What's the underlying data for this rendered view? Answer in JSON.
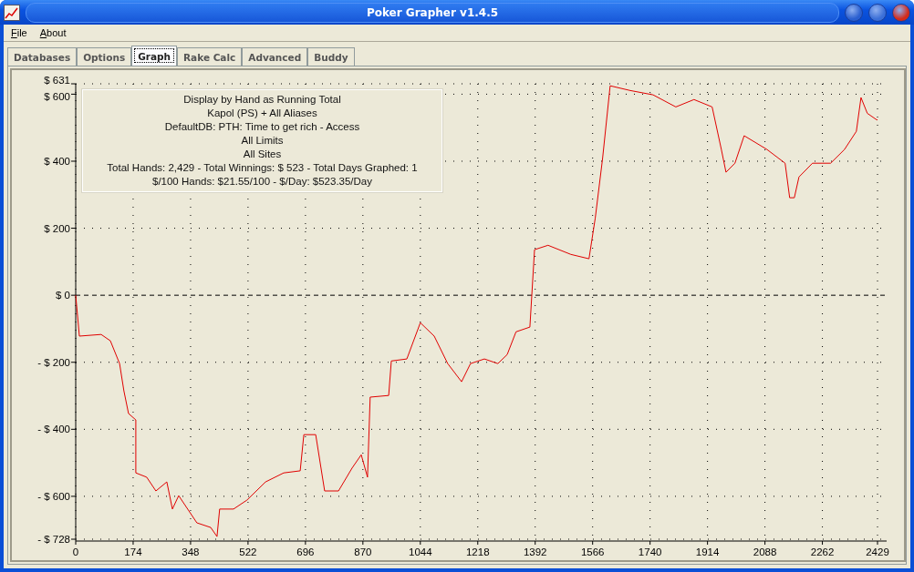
{
  "window": {
    "title": "Poker Grapher v1.4.5"
  },
  "menu": [
    "File",
    "About"
  ],
  "tabs": [
    {
      "label": "Databases",
      "selected": false
    },
    {
      "label": "Options",
      "selected": false
    },
    {
      "label": "Graph",
      "selected": true
    },
    {
      "label": "Rake Calc",
      "selected": false
    },
    {
      "label": "Advanced",
      "selected": false
    },
    {
      "label": "Buddy",
      "selected": false
    }
  ],
  "info_box": [
    "Display by Hand as Running Total",
    "Kapol (PS) + All Aliases",
    "DefaultDB: PTH: Time to get rich - Access",
    "All Limits",
    "All Sites",
    "Total Hands: 2,429 - Total Winnings: $ 523 - Total Days Graphed: 1",
    "$/100 Hands: $21.55/100 - $/Day: $523.35/Day"
  ],
  "chart": {
    "chart_data": {
      "type": "line",
      "grid": true,
      "xlim": [
        0,
        2429
      ],
      "ylim": [
        -728,
        631
      ],
      "xticks": [
        0,
        174,
        348,
        522,
        696,
        870,
        1044,
        1218,
        1392,
        1566,
        1740,
        1914,
        2088,
        2262,
        2429
      ],
      "yticks": [
        {
          "value": 631,
          "label": "$ 631"
        },
        {
          "value": 600,
          "label": "$ 600"
        },
        {
          "value": 400,
          "label": "$ 400"
        },
        {
          "value": 200,
          "label": "$ 200"
        },
        {
          "value": 0,
          "label": "$ 0"
        },
        {
          "value": -200,
          "label": "- $ 200"
        },
        {
          "value": -400,
          "label": "- $ 400"
        },
        {
          "value": -600,
          "label": "- $ 600"
        },
        {
          "value": -728,
          "label": "- $ 728"
        }
      ],
      "x": [
        0,
        11,
        77,
        105,
        133,
        146,
        160,
        182,
        182,
        215,
        243,
        276,
        293,
        312,
        367,
        409,
        428,
        436,
        478,
        519,
        575,
        630,
        680,
        691,
        727,
        754,
        796,
        837,
        865,
        884,
        892,
        948,
        956,
        1003,
        1044,
        1086,
        1127,
        1169,
        1196,
        1238,
        1279,
        1307,
        1334,
        1376,
        1390,
        1431,
        1500,
        1555,
        1574,
        1596,
        1619,
        1680,
        1749,
        1818,
        1873,
        1928,
        1956,
        1970,
        1997,
        2025,
        2094,
        2149,
        2163,
        2177,
        2191,
        2232,
        2287,
        2329,
        2365,
        2379,
        2398,
        2426,
        2429
      ],
      "series": [
        {
          "color": "#e00000",
          "values": [
            0,
            -122,
            -117,
            -136,
            -204,
            -285,
            -353,
            -372,
            -530,
            -543,
            -584,
            -557,
            -638,
            -598,
            -679,
            -693,
            -720,
            -638,
            -638,
            -611,
            -557,
            -530,
            -524,
            -416,
            -416,
            -584,
            -584,
            -516,
            -476,
            -543,
            -304,
            -299,
            -196,
            -190,
            -82,
            -122,
            -204,
            -258,
            -204,
            -190,
            -204,
            -177,
            -109,
            -95,
            136,
            149,
            122,
            109,
            231,
            408,
            625,
            611,
            598,
            562,
            584,
            562,
            435,
            367,
            394,
            476,
            435,
            394,
            291,
            291,
            353,
            394,
            394,
            435,
            489,
            590,
            543,
            524,
            523
          ]
        }
      ]
    }
  }
}
